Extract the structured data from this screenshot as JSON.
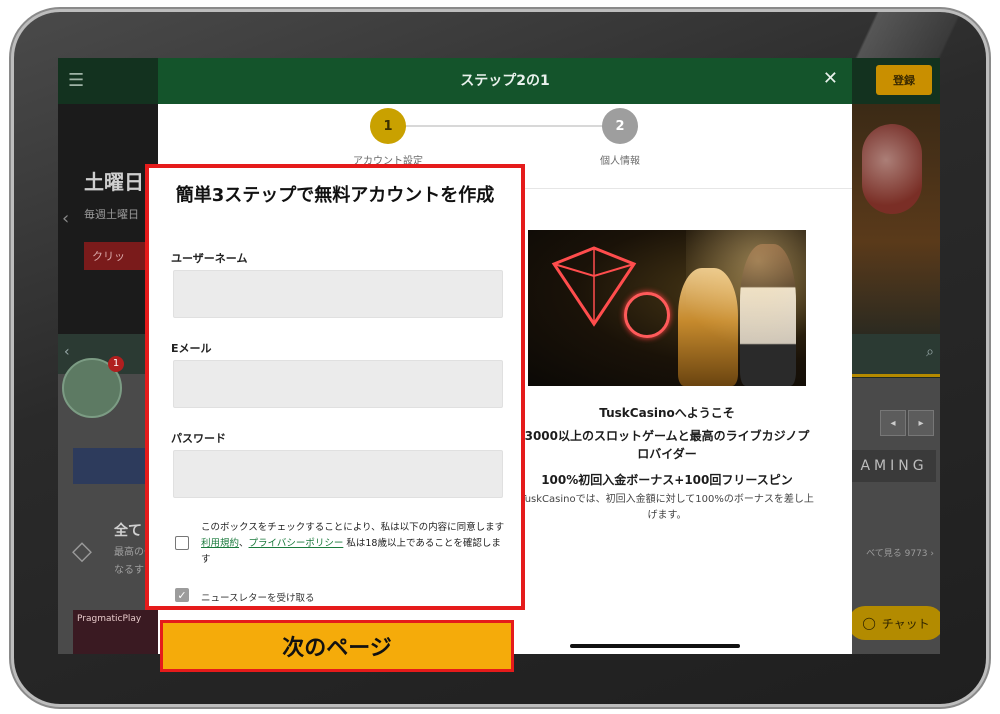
{
  "site": {
    "register_label": "登録",
    "hero_title": "土曜日",
    "hero_subtitle": "毎週土曜日",
    "hero_cta": "クリッ",
    "section_title": "全て",
    "section_text": "最高の一なるす",
    "provider_tile": "PragmaticPlay",
    "gaming_logo": "AMING",
    "see_all": "べて見る 9773 ›",
    "chat_label": "チャット",
    "badge_count": "1"
  },
  "modal": {
    "title": "ステップ2の1",
    "steps": [
      {
        "number": "1",
        "label": "アカウント設定"
      },
      {
        "number": "2",
        "label": "個人情報"
      }
    ],
    "promo": {
      "welcome": "TuskCasinoへようこそ",
      "line1": "3000以上のスロットゲームと最高のライブカジノプロバイダー",
      "line2": "100%初回入金ボーナス+100回フリースピン",
      "line3": "TuskCasinoでは、初回入金額に対して100%のボーナスを差し上げます。"
    }
  },
  "form": {
    "heading": "簡単3ステップで無料アカウントを作成",
    "username_label": "ユーザーネーム",
    "username_value": "",
    "email_label": "Eメール",
    "email_value": "",
    "password_label": "パスワード",
    "password_value": "",
    "consent_pre": "このボックスをチェックすることにより、私は以下の内容に同意します",
    "terms_link": "利用規約",
    "privacy_link": "プライバシーポリシー",
    "consent_post": "私は18歳以上であることを確認します",
    "newsletter_label": "ニュースレターを受け取る",
    "next_button": "次のページ"
  },
  "colors": {
    "accent_green": "#14542b",
    "step_active": "#c9a100",
    "highlight_red": "#e51b1b",
    "next_button": "#f5ab0a"
  }
}
